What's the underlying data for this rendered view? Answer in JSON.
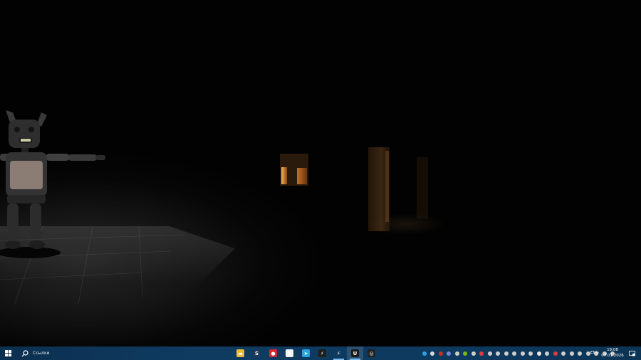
{
  "window": {
    "type": "desktop-with-fullscreen-game"
  },
  "taskbar": {
    "search_placeholder": "Ссылки",
    "pinned_apps": [
      {
        "name": "file-explorer-icon",
        "color": "#e8b93a",
        "glyph": "▬",
        "running": false
      },
      {
        "name": "steam-icon",
        "color": "#1b3a5a",
        "glyph": "S",
        "running": false
      },
      {
        "name": "yandex-browser-icon",
        "color": "#d12a2a",
        "glyph": "●",
        "running": false
      },
      {
        "name": "yandex-icon",
        "color": "#f2f2f2",
        "glyph": "Y",
        "running": false
      },
      {
        "name": "telegram-icon",
        "color": "#2aa3e0",
        "glyph": "➤",
        "running": false
      },
      {
        "name": "game-launcher-icon",
        "color": "#1e1e1e",
        "glyph": "⚡",
        "running": false
      },
      {
        "name": "app-bolt-icon",
        "color": "#0f3b61",
        "glyph": "⚡",
        "running": true
      },
      {
        "name": "unreal-engine-icon",
        "color": "#1a1a1a",
        "glyph": "U",
        "running": true,
        "active": true
      },
      {
        "name": "game-window-icon",
        "color": "#222222",
        "glyph": "◎",
        "running": false
      }
    ],
    "tray_icons": [
      {
        "name": "telegram-tray-icon",
        "color": "#2aa3e0"
      },
      {
        "name": "headset-tray-icon",
        "color": "#d9d9d9"
      },
      {
        "name": "yandex-tray-icon",
        "color": "#d12a2a"
      },
      {
        "name": "discord-tray-icon",
        "color": "#7289da"
      },
      {
        "name": "c-tray-icon",
        "color": "#cfcfcf"
      },
      {
        "name": "nvidia-tray-icon",
        "color": "#76b900"
      },
      {
        "name": "controller-tray-icon",
        "color": "#cfcfcf"
      },
      {
        "name": "mic-red-tray-icon",
        "color": "#e23b3b"
      },
      {
        "name": "arrow-tray-icon",
        "color": "#cfcfcf"
      },
      {
        "name": "b-tray-icon",
        "color": "#cfcfcf"
      },
      {
        "name": "bolt-tray-icon",
        "color": "#cfcfcf"
      },
      {
        "name": "x-tray-icon",
        "color": "#cfcfcf"
      },
      {
        "name": "gear-tray-icon",
        "color": "#cfcfcf"
      },
      {
        "name": "cloud-tray-icon",
        "color": "#cfcfcf"
      },
      {
        "name": "onedrive-tray-icon",
        "color": "#e7e7e7"
      },
      {
        "name": "clock-tray-icon",
        "color": "#cfcfcf"
      },
      {
        "name": "record-tray-icon",
        "color": "#e23b3b"
      },
      {
        "name": "shield-tray-icon",
        "color": "#cfcfcf"
      },
      {
        "name": "steam-tray-icon",
        "color": "#cfcfcf"
      },
      {
        "name": "chevron-up-tray-icon",
        "color": "#cfcfcf"
      },
      {
        "name": "network-tray-icon",
        "color": "#cfcfcf"
      },
      {
        "name": "volume-tray-icon",
        "color": "#cfcfcf"
      },
      {
        "name": "microphone-tray-icon",
        "color": "#cfcfcf"
      },
      {
        "name": "keyboard-tray-icon",
        "color": "#cfcfcf"
      }
    ],
    "language": "ENG",
    "time": "19:08",
    "date": "07.01.2026"
  }
}
